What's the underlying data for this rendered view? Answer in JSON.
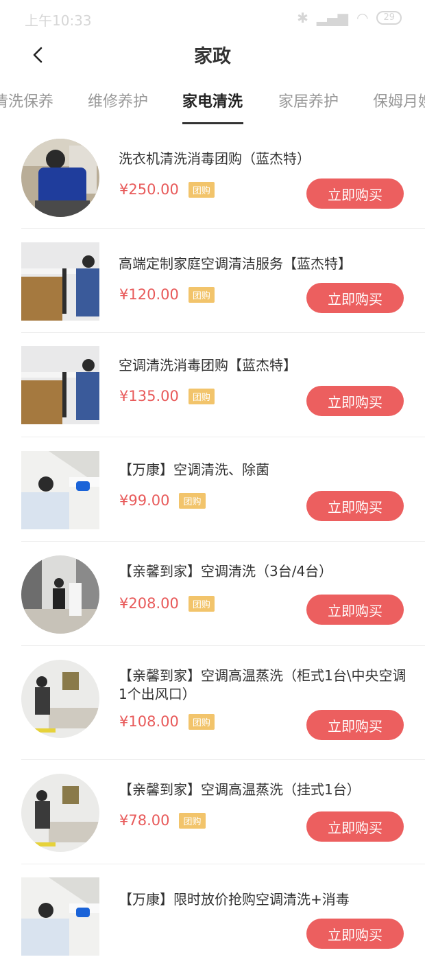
{
  "status_bar": {
    "time": "上午10:33",
    "battery": "29"
  },
  "nav": {
    "title": "家政"
  },
  "tabs": [
    "清洗保养",
    "维修养护",
    "家电清洗",
    "家居养护",
    "保姆月嫂"
  ],
  "currency": "¥",
  "badge_label": "团购",
  "buy_label": "立即购买",
  "colors": {
    "price": "#e85a5a",
    "buy_button": "#ec5f5f",
    "badge": "#f2c46b"
  },
  "items": [
    {
      "title": "洗衣机清洗消毒团购（蓝杰特）",
      "price": "¥250.00"
    },
    {
      "title": "高端定制家庭空调清洁服务【蓝杰特】",
      "price": "¥120.00"
    },
    {
      "title": "空调清洗消毒团购【蓝杰特】",
      "price": "¥135.00"
    },
    {
      "title": "【万康】空调清洗、除菌",
      "price": "¥99.00"
    },
    {
      "title": "【亲馨到家】空调清洗（3台/4台）",
      "price": "¥208.00"
    },
    {
      "title": "【亲馨到家】空调高温蒸洗（柜式1台\\中央空调1个出风口）",
      "price": "¥108.00"
    },
    {
      "title": "【亲馨到家】空调高温蒸洗（挂式1台）",
      "price": "¥78.00"
    },
    {
      "title": "【万康】限时放价抢购空调清洗+消毒",
      "price": ""
    }
  ]
}
